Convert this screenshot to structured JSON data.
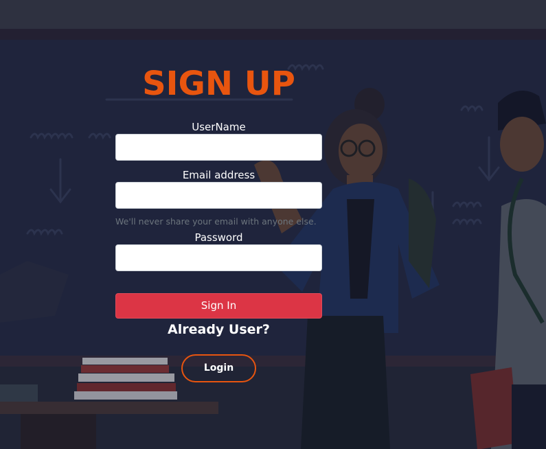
{
  "signup": {
    "title": "SIGN UP",
    "username_label": "UserName",
    "username_value": "",
    "email_label": "Email address",
    "email_value": "",
    "email_help": "We'll never share your email with anyone else.",
    "password_label": "Password",
    "password_value": "",
    "signin_label": "Sign In",
    "already_text": "Already User?",
    "login_label": "Login"
  },
  "colors": {
    "accent": "#e8550f",
    "signin_button": "#dc3545",
    "background": "#252c47"
  },
  "background_icons": [
    "teacher-illustration",
    "student-girl-illustration",
    "student-boy-illustration",
    "book-stack-illustration",
    "chalkboard"
  ]
}
